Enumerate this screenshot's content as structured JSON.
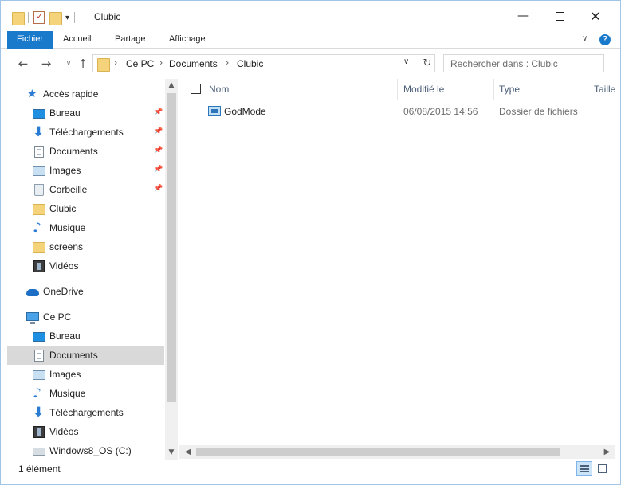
{
  "window": {
    "title": "Clubic"
  },
  "ribbon": {
    "tabs": [
      "Fichier",
      "Accueil",
      "Partage",
      "Affichage"
    ],
    "help": "?"
  },
  "address": {
    "crumbs": [
      "Ce PC",
      "Documents",
      "Clubic"
    ],
    "search_placeholder": "Rechercher dans : Clubic"
  },
  "nav": {
    "quick_access": "Accès rapide",
    "quick_items": [
      {
        "label": "Bureau",
        "icon": "desktop-icon",
        "pinned": true
      },
      {
        "label": "Téléchargements",
        "icon": "download-icon",
        "pinned": true
      },
      {
        "label": "Documents",
        "icon": "document-icon",
        "pinned": true
      },
      {
        "label": "Images",
        "icon": "picture-icon",
        "pinned": true
      },
      {
        "label": "Corbeille",
        "icon": "recycle-bin-icon",
        "pinned": true
      },
      {
        "label": "Clubic",
        "icon": "folder-icon",
        "pinned": false
      },
      {
        "label": "Musique",
        "icon": "music-icon",
        "pinned": false
      },
      {
        "label": "screens",
        "icon": "folder-icon",
        "pinned": false
      },
      {
        "label": "Vidéos",
        "icon": "video-icon",
        "pinned": false
      }
    ],
    "onedrive": "OneDrive",
    "this_pc": "Ce PC",
    "pc_items": [
      {
        "label": "Bureau",
        "icon": "desktop-icon"
      },
      {
        "label": "Documents",
        "icon": "document-icon",
        "selected": true
      },
      {
        "label": "Images",
        "icon": "picture-icon"
      },
      {
        "label": "Musique",
        "icon": "music-icon"
      },
      {
        "label": "Téléchargements",
        "icon": "download-icon"
      },
      {
        "label": "Vidéos",
        "icon": "video-icon"
      },
      {
        "label": "Windows8_OS (C:)",
        "icon": "drive-icon"
      }
    ]
  },
  "content": {
    "columns": [
      "Nom",
      "Modifié le",
      "Type",
      "Taille"
    ],
    "rows": [
      {
        "name": "GodMode",
        "modified": "06/08/2015 14:56",
        "type": "Dossier de fichiers",
        "size": ""
      }
    ]
  },
  "status": {
    "text": "1 élément"
  },
  "colors": {
    "accent": "#1979ca",
    "selection": "#d9d9d9",
    "column_text": "#4c607a"
  }
}
